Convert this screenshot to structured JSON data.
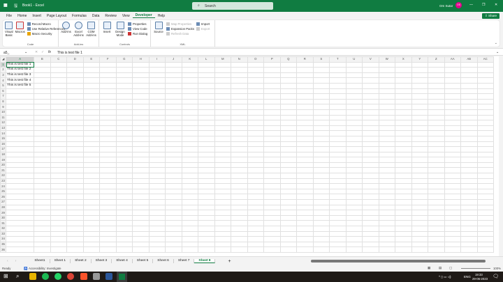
{
  "titlebar": {
    "autosave_icon": "save-icon",
    "title": "Book1 - Excel",
    "search_placeholder": "Search",
    "user": "Om Sutar",
    "avatar_initials": "OS",
    "accent": "#107c41"
  },
  "menu": [
    "File",
    "Home",
    "Insert",
    "Page Layout",
    "Formulas",
    "Data",
    "Review",
    "View",
    "Developer",
    "Help"
  ],
  "active_menu": "Developer",
  "share": "Share",
  "ribbon": {
    "code": {
      "label": "Code",
      "visual_basic": "Visual Basic",
      "macros": "Macros",
      "record_macro": "Record Macro",
      "relative": "Use Relative References",
      "security": "Macro Security"
    },
    "addins": {
      "label": "Add-ins",
      "addins": "Add-ins",
      "excel_addins": "Excel Add-ins",
      "com_addins": "COM Add-ins"
    },
    "controls": {
      "label": "Controls",
      "insert": "Insert",
      "design_mode": "Design Mode",
      "properties": "Properties",
      "view_code": "View Code",
      "run_dialog": "Run Dialog"
    },
    "xml": {
      "label": "XML",
      "source": "Source",
      "map_properties": "Map Properties",
      "expansion_packs": "Expansion Packs",
      "refresh_data": "Refresh Data",
      "import": "Import",
      "export": "Export"
    }
  },
  "formula_bar": {
    "name_box": "a5_",
    "fx": "fx",
    "value": "This is test file 1"
  },
  "columns": [
    "A",
    "B",
    "C",
    "D",
    "E",
    "F",
    "G",
    "H",
    "I",
    "J",
    "K",
    "L",
    "M",
    "N",
    "O",
    "P",
    "Q",
    "R",
    "S",
    "T",
    "U",
    "V",
    "W",
    "X",
    "Y",
    "Z",
    "AA",
    "AB",
    "AC"
  ],
  "row_count": 36,
  "cells": [
    "This is test file 1",
    "This is test file 2",
    "This is test file 3",
    "This is test file 4",
    "This is test file 5"
  ],
  "sheets": [
    "Sheet1",
    "Sheet 1",
    "Sheet 2",
    "Sheet 3",
    "Sheet 4",
    "Sheet 5",
    "Sheet 6",
    "Sheet 7",
    "Sheet 8"
  ],
  "active_sheet": "Sheet 8",
  "add_sheet": "+",
  "status": {
    "ready": "Ready",
    "accessibility": "Accessibility: Investigate",
    "zoom": "100%"
  },
  "taskbar": {
    "lang": "ENG",
    "time": "19:33",
    "date": "29-06-2023"
  }
}
